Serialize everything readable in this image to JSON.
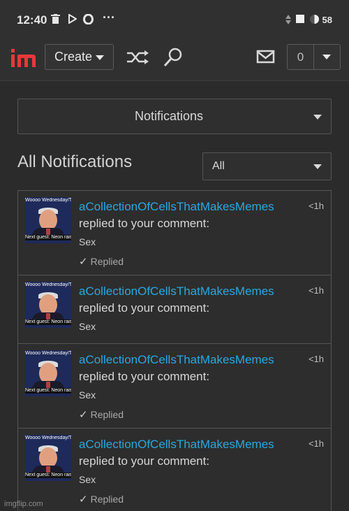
{
  "status_bar": {
    "time": "12:40",
    "battery": "58",
    "icons": [
      "trash-icon",
      "play-icon",
      "opera-icon",
      "more-dots-icon",
      "signal-icon",
      "wifi-square-icon",
      "battery-icon"
    ]
  },
  "header": {
    "logo_text": "im",
    "create_label": "Create",
    "notification_count": "0",
    "colors": {
      "logo_red": "#e8383c",
      "logo_blue": "#1a74d6"
    }
  },
  "notifications_select": {
    "label": "Notifications"
  },
  "section": {
    "title": "All Notifications",
    "filter_value": "All"
  },
  "notifications": [
    {
      "username": "aCollectionOfCellsThatMakesMemes",
      "time": "<1h",
      "action": "replied to your comment:",
      "comment": "Sex",
      "status": "Replied",
      "thumb_top": "Woooo Wednesday/Th evening/morning ever",
      "thumb_bottom": "Next guest: Neon raise"
    },
    {
      "username": "aCollectionOfCellsThatMakesMemes",
      "time": "<1h",
      "action": "replied to your comment:",
      "comment": "Sex",
      "status": "",
      "thumb_top": "Woooo Wednesday/Th evening/morning ever",
      "thumb_bottom": "Next guest: Neon raise"
    },
    {
      "username": "aCollectionOfCellsThatMakesMemes",
      "time": "<1h",
      "action": "replied to your comment:",
      "comment": "Sex",
      "status": "Replied",
      "thumb_top": "Woooo Wednesday/Th evening/morning ever",
      "thumb_bottom": "Next guest: Neon raise"
    },
    {
      "username": "aCollectionOfCellsThatMakesMemes",
      "time": "<1h",
      "action": "replied to your comment:",
      "comment": "Sex",
      "status": "Replied",
      "thumb_top": "Woooo Wednesday/Th evening/morning ever",
      "thumb_bottom": "Next guest: Neon raise"
    }
  ],
  "watermark": "imgflip.com",
  "colors": {
    "background": "#2b2b2b",
    "link": "#29a8e0"
  }
}
